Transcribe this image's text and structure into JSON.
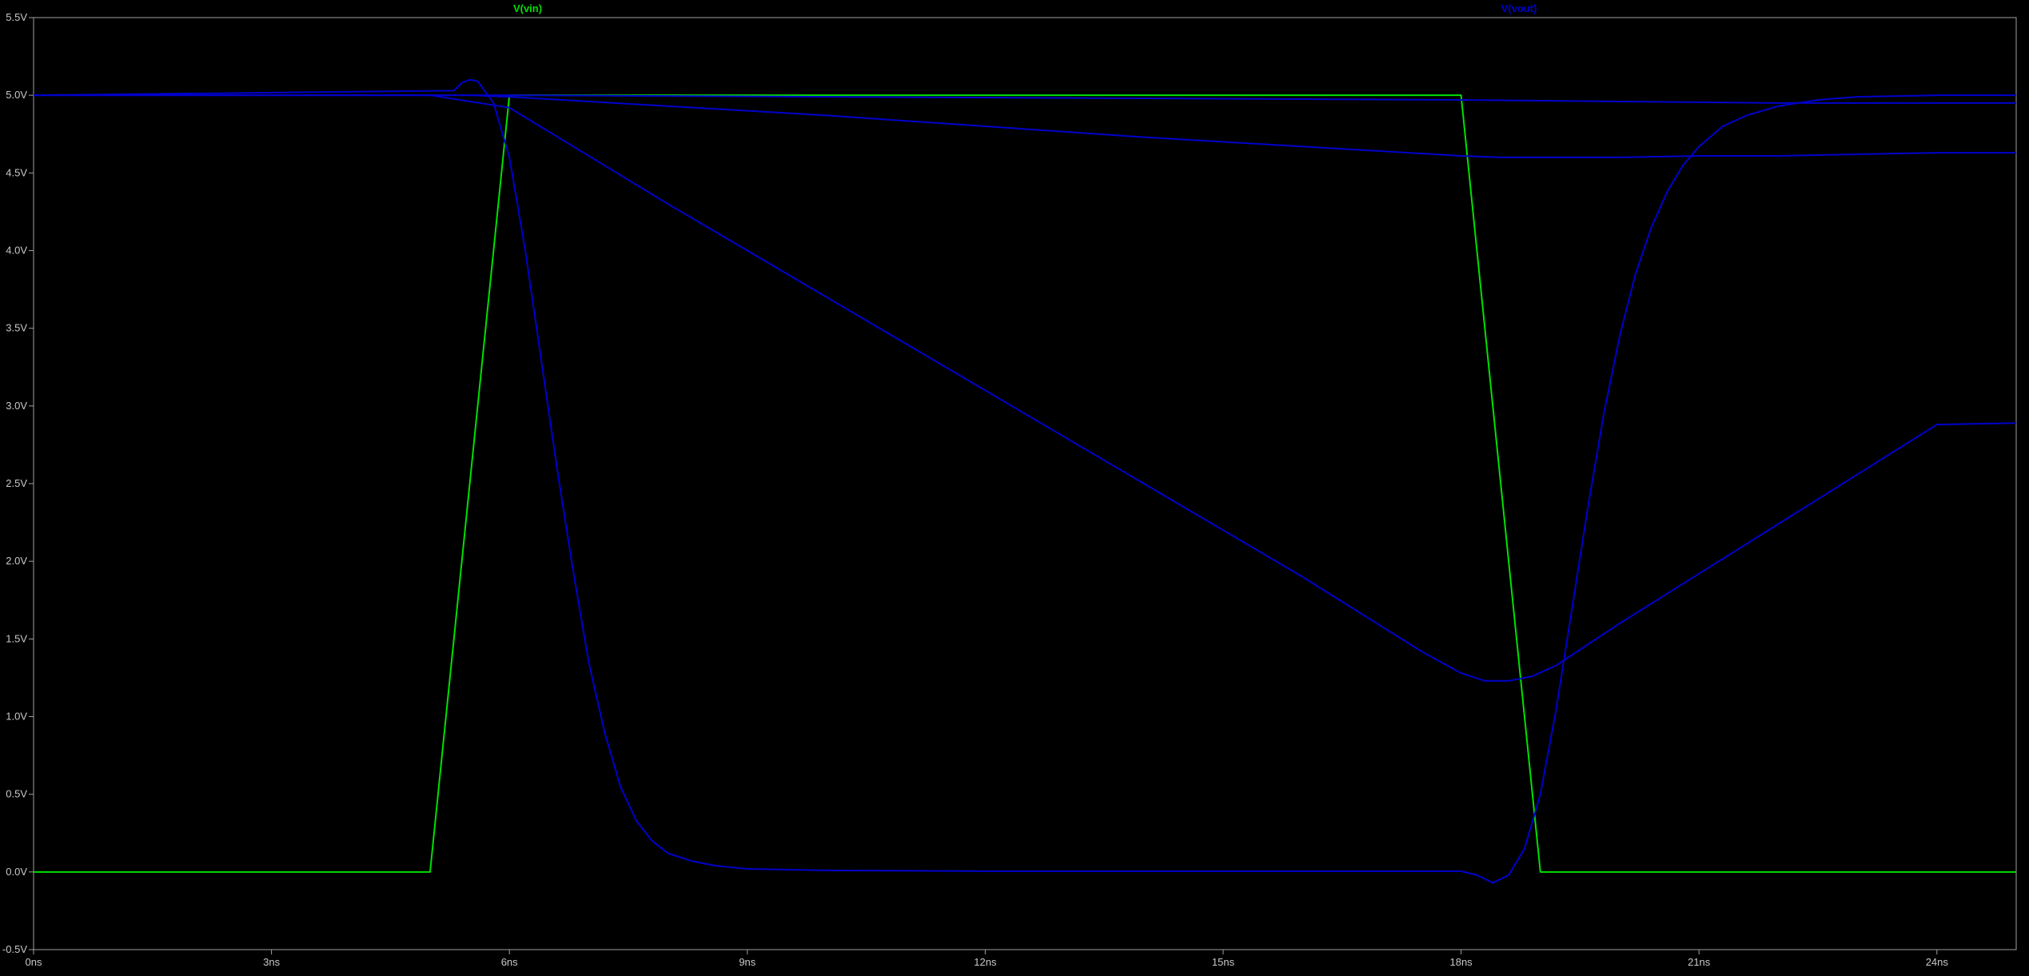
{
  "chart_data": {
    "type": "line",
    "title": "",
    "xlabel": "",
    "ylabel": "",
    "grid": false,
    "background_color": "#000000",
    "axis_color": "#a0a0a0",
    "tick_label_color": "#c8c8c8",
    "xlim": [
      0,
      25
    ],
    "ylim": [
      -0.5,
      5.5
    ],
    "x_ticks": [
      0,
      3,
      6,
      9,
      12,
      15,
      18,
      21,
      24
    ],
    "x_tick_labels": [
      "0ns",
      "3ns",
      "6ns",
      "9ns",
      "12ns",
      "15ns",
      "18ns",
      "21ns",
      "24ns"
    ],
    "y_ticks": [
      -0.5,
      0,
      0.5,
      1,
      1.5,
      2,
      2.5,
      3,
      3.5,
      4,
      4.5,
      5,
      5.5
    ],
    "y_tick_labels": [
      "-0.5V",
      "0.0V",
      "0.5V",
      "1.0V",
      "1.5V",
      "2.0V",
      "2.5V",
      "3.0V",
      "3.5V",
      "4.0V",
      "4.5V",
      "5.0V",
      "5.5V"
    ],
    "legend_entries": [
      {
        "label": "V(vin)",
        "color": "#00e000",
        "position": "top-left"
      },
      {
        "label": "V(vout)",
        "color": "#0000cc",
        "position": "top-right"
      }
    ],
    "series": [
      {
        "color": "#00e000",
        "x": [
          0,
          5,
          6,
          18,
          19,
          25
        ],
        "y": [
          0,
          0,
          5,
          5,
          0,
          0
        ]
      },
      {
        "color": "#0000cc",
        "x": [
          0,
          5.3,
          5.4,
          5.5,
          5.6,
          5.8,
          6,
          6.2,
          6.4,
          6.6,
          6.8,
          7,
          7.2,
          7.4,
          7.6,
          7.8,
          8,
          8.3,
          8.6,
          9,
          10,
          12,
          15,
          18,
          18.2,
          18.4,
          18.6,
          18.8,
          19,
          19.2,
          19.4,
          19.6,
          19.8,
          20,
          20.2,
          20.4,
          20.6,
          20.8,
          21,
          21.3,
          21.6,
          22,
          22.5,
          23,
          24,
          25
        ],
        "y": [
          5,
          5.03,
          5.08,
          5.1,
          5.09,
          4.95,
          4.6,
          4.0,
          3.3,
          2.6,
          1.95,
          1.35,
          0.9,
          0.55,
          0.33,
          0.2,
          0.12,
          0.07,
          0.04,
          0.02,
          0.01,
          0.005,
          0.005,
          0.005,
          -0.02,
          -0.07,
          -0.02,
          0.15,
          0.5,
          1.05,
          1.7,
          2.35,
          2.95,
          3.45,
          3.85,
          4.15,
          4.38,
          4.55,
          4.67,
          4.8,
          4.87,
          4.93,
          4.97,
          4.99,
          5.0,
          5.0
        ]
      },
      {
        "color": "#0000cc",
        "x": [
          0,
          5,
          6,
          8,
          10,
          12,
          14,
          16,
          17,
          17.5,
          18,
          18.3,
          18.6,
          18.9,
          19.2,
          20,
          21,
          22,
          23,
          24,
          25
        ],
        "y": [
          5,
          5,
          4.92,
          4.3,
          3.7,
          3.1,
          2.5,
          1.9,
          1.58,
          1.42,
          1.28,
          1.23,
          1.23,
          1.26,
          1.33,
          1.6,
          1.92,
          2.24,
          2.56,
          2.88,
          2.89
        ]
      },
      {
        "color": "#0000cc",
        "x": [
          0,
          5.5,
          6,
          8,
          10,
          12,
          14,
          16,
          17,
          18,
          18.5,
          19,
          20,
          21,
          22,
          23,
          24,
          25
        ],
        "y": [
          5,
          5.0,
          4.99,
          4.93,
          4.87,
          4.8,
          4.73,
          4.67,
          4.64,
          4.61,
          4.6,
          4.6,
          4.6,
          4.61,
          4.61,
          4.62,
          4.63,
          4.63
        ]
      },
      {
        "color": "#0000cc",
        "x": [
          0,
          5,
          6,
          10,
          14,
          18,
          20,
          22,
          25
        ],
        "y": [
          5,
          5,
          5.0,
          4.99,
          4.98,
          4.97,
          4.96,
          4.95,
          4.95
        ]
      }
    ]
  }
}
